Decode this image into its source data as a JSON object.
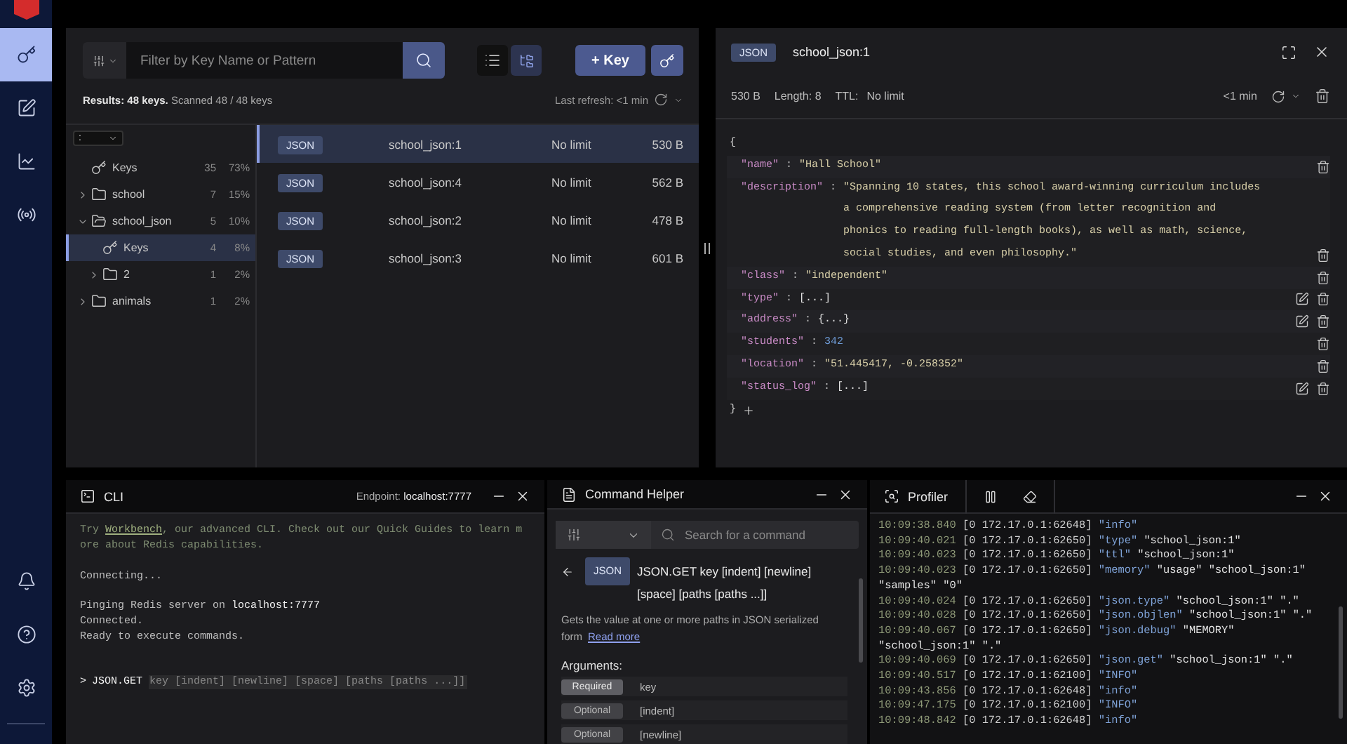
{
  "nav": {
    "top": [
      {
        "selected": true
      },
      {
        "selected": false
      },
      {
        "selected": false
      },
      {
        "selected": false
      }
    ],
    "bottom": [
      {
        "selected": false
      },
      {
        "selected": false
      },
      {
        "selected": false
      }
    ]
  },
  "browser": {
    "filter_placeholder": "Filter by Key Name or Pattern",
    "views": [
      {
        "selected": false
      },
      {
        "selected": true
      }
    ],
    "add_button": "+ Key",
    "results": "**Results: 48 keys.** Scanned 48 / 48 keys",
    "last_refresh": "Last refresh: <1 min",
    "delimiter": ":",
    "tree": [
      {
        "name": "Keys",
        "kind": "keys",
        "count": "35",
        "percent": "73%",
        "selected": false
      },
      {
        "name": "school",
        "kind": "folder",
        "count": "7",
        "percent": "15%",
        "expanded": false,
        "selected": false
      },
      {
        "name": "school_json",
        "kind": "folder",
        "count": "5",
        "percent": "10%",
        "expanded": true,
        "selected": false,
        "children": [
          {
            "name": "Keys",
            "kind": "keys",
            "count": "4",
            "percent": "8%",
            "selected": true
          },
          {
            "name": "2",
            "kind": "folder",
            "count": "1",
            "percent": "2%",
            "expanded": false,
            "selected": false
          }
        ]
      },
      {
        "name": "animals",
        "kind": "folder",
        "count": "1",
        "percent": "2%",
        "expanded": false,
        "selected": false
      }
    ],
    "rows": [
      {
        "type": "JSON",
        "name": "school_json:1",
        "ttl": "No limit",
        "size": "530 B",
        "selected": true
      },
      {
        "type": "JSON",
        "name": "school_json:4",
        "ttl": "No limit",
        "size": "562 B",
        "selected": false
      },
      {
        "type": "JSON",
        "name": "school_json:2",
        "ttl": "No limit",
        "size": "478 B",
        "selected": false
      },
      {
        "type": "JSON",
        "name": "school_json:3",
        "ttl": "No limit",
        "size": "601 B",
        "selected": false
      }
    ]
  },
  "details": {
    "type": "JSON",
    "key": "school_json:1",
    "size": "530 B",
    "length": "Length: 8",
    "ttl_label": "TTL:",
    "ttl": "No limit",
    "refresh": "<1 min",
    "open_brace": "{",
    "close_brace": "}",
    "fields": [
      {
        "key": "\"name\"",
        "colon": ":",
        "value": "\"Hall School\"",
        "kind": "string",
        "editable": false
      },
      {
        "key": "\"description\"",
        "colon": ":",
        "value": "\"Spanning 10 states, this school award-winning curriculum includes a comprehensive reading system (from letter recognition and phonics to reading full-length books), as well as math, science, social studies, and even philosophy.\"",
        "kind": "string",
        "editable": false
      },
      {
        "key": "\"class\"",
        "colon": ":",
        "value": "\"independent\"",
        "kind": "string",
        "editable": false
      },
      {
        "key": "\"type\"",
        "colon": ":",
        "value": "[...]",
        "kind": "collapsed",
        "editable": true
      },
      {
        "key": "\"address\"",
        "colon": ":",
        "value": "{...}",
        "kind": "collapsed",
        "editable": true
      },
      {
        "key": "\"students\"",
        "colon": ":",
        "value": "342",
        "kind": "number",
        "editable": false
      },
      {
        "key": "\"location\"",
        "colon": ":",
        "value": "\"51.445417, -0.258352\"",
        "kind": "string",
        "editable": false
      },
      {
        "key": "\"status_log\"",
        "colon": ":",
        "value": "[...]",
        "kind": "collapsed",
        "editable": true
      }
    ]
  },
  "cli": {
    "title": "CLI",
    "endpoint_label": "Endpoint:",
    "endpoint": "localhost:7777",
    "intro": {
      "before": "Try ",
      "link": "Workbench",
      "after": ", our advanced CLI. Check out our Quick Guides to learn more about Redis capabilities."
    },
    "blocks": [
      [
        "Connecting..."
      ],
      [
        "Pinging Redis server on **localhost:7777**",
        "Connected.",
        "Ready to execute commands."
      ]
    ],
    "prompt": ">",
    "command": "JSON.GET",
    "hint": "key [indent] [newline] [space] [paths [paths ...]]"
  },
  "helper": {
    "title": "Command Helper",
    "search_placeholder": "Search for a command",
    "group": "JSON",
    "signature": "JSON.GET key [indent] [newline] [space] [paths [paths ...]]",
    "summary": "Gets the value at one or more paths in JSON serialized form",
    "link": "Read more",
    "arguments_label": "Arguments:",
    "arguments": [
      {
        "kind": "required",
        "label": "Required",
        "name": "key"
      },
      {
        "kind": "optional",
        "label": "Optional",
        "name": "[indent]"
      },
      {
        "kind": "optional",
        "label": "Optional",
        "name": "[newline]"
      }
    ]
  },
  "profiler": {
    "title": "Profiler",
    "lines": [
      {
        "time": "10:09:38.840",
        "client": "[0 172.17.0.1:62648]",
        "args": [
          "\"info\""
        ]
      },
      {
        "time": "10:09:40.021",
        "client": "[0 172.17.0.1:62650]",
        "args": [
          "\"type\"",
          "\"school_json:1\""
        ]
      },
      {
        "time": "10:09:40.023",
        "client": "[0 172.17.0.1:62650]",
        "args": [
          "\"ttl\"",
          "\"school_json:1\""
        ]
      },
      {
        "time": "10:09:40.023",
        "client": "[0 172.17.0.1:62650]",
        "args": [
          "\"memory\"",
          "\"usage\"",
          "\"school_json:1\"",
          "\"samples\"",
          "\"0\""
        ]
      },
      {
        "time": "10:09:40.024",
        "client": "[0 172.17.0.1:62650]",
        "args": [
          "\"json.type\"",
          "\"school_json:1\"",
          "\".\""
        ]
      },
      {
        "time": "10:09:40.028",
        "client": "[0 172.17.0.1:62650]",
        "args": [
          "\"json.objlen\"",
          "\"school_json:1\"",
          "\".\""
        ]
      },
      {
        "time": "10:09:40.067",
        "client": "[0 172.17.0.1:62650]",
        "args": [
          "\"json.debug\"",
          "\"MEMORY\"",
          "\"school_json:1\"",
          "\".\""
        ]
      },
      {
        "time": "10:09:40.069",
        "client": "[0 172.17.0.1:62650]",
        "args": [
          "\"json.get\"",
          "\"school_json:1\"",
          "\".\""
        ]
      },
      {
        "time": "10:09:40.517",
        "client": "[0 172.17.0.1:62100]",
        "args": [
          "\"INFO\""
        ]
      },
      {
        "time": "10:09:43.856",
        "client": "[0 172.17.0.1:62648]",
        "args": [
          "\"info\""
        ]
      },
      {
        "time": "10:09:47.175",
        "client": "[0 172.17.0.1:62100]",
        "args": [
          "\"INFO\""
        ]
      },
      {
        "time": "10:09:48.842",
        "client": "[0 172.17.0.1:62648]",
        "args": [
          "\"info\""
        ]
      }
    ]
  }
}
